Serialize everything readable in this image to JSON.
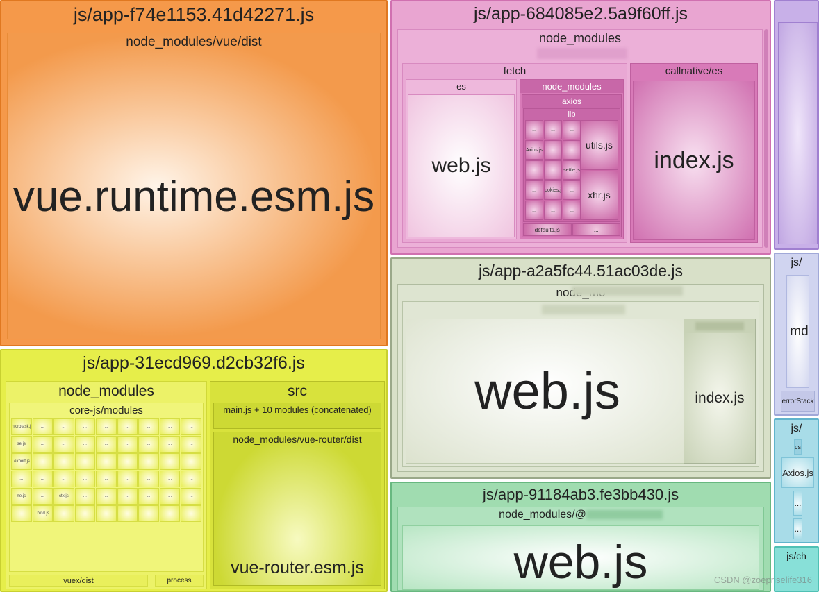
{
  "watermark": "CSDN @zoepriselife316",
  "bundles": {
    "orange": {
      "title": "js/app-f74e1153.41d42271.js",
      "path": "node_modules/vue/dist",
      "file": "vue.runtime.esm.js"
    },
    "yellow": {
      "title": "js/app-31ecd969.d2cb32f6.js",
      "nm": {
        "label": "node_modules",
        "core": "core-js/modules",
        "cells": [
          ".microtask.js",
          "...",
          "...",
          "...",
          "...",
          "...",
          "...",
          "...",
          "...",
          "se.js",
          "...",
          "...",
          "...",
          "...",
          "...",
          "...",
          "...",
          "...",
          ".export.js",
          "...",
          "...",
          "...",
          "...",
          "...",
          "...",
          "...",
          "...",
          "...",
          "...",
          "...",
          "...",
          "...",
          "...",
          "...",
          "...",
          "...",
          "ne.js",
          "...",
          "ctx.js",
          "...",
          "...",
          "...",
          "...",
          "...",
          "...",
          "...",
          ".bind.js",
          "...",
          "...",
          "...",
          "...",
          "...",
          "...",
          ""
        ],
        "vuex": "vuex/dist",
        "process": "process"
      },
      "src": {
        "label": "src",
        "main": "main.js + 10 modules (concatenated)",
        "router_path": "node_modules/vue-router/dist",
        "router_file": "vue-router.esm.js"
      }
    },
    "pink": {
      "title": "js/app-684085e2.5a9f60ff.js",
      "nm": "node_modules",
      "fetch": {
        "label": "fetch",
        "es": {
          "label": "es",
          "file": "web.js"
        },
        "nm2": "node_modules",
        "axios": {
          "label": "axios",
          "lib": "lib",
          "leftCells": [
            "...",
            "...",
            "...",
            "Axios.js",
            "...",
            "...",
            "...",
            "...",
            "settle.js",
            "...",
            "cookies.js",
            "...",
            "...",
            "...",
            "..."
          ],
          "right": [
            "utils.js",
            "xhr.js"
          ],
          "bot": [
            "defaults.js",
            "..."
          ]
        }
      },
      "call": {
        "label": "callnative/es",
        "file": "index.js"
      }
    },
    "olive": {
      "title": "js/app-a2a5fc44.51ac03de.js",
      "nm": "node_mo",
      "web": "web.js",
      "idx_suffix": "s",
      "idx": "index.js"
    },
    "green": {
      "title": "js/app-91184ab3.fe3bb430.js",
      "nm": "node_modules/@",
      "file": "web.js"
    },
    "purple": {
      "title": ""
    },
    "lavender": {
      "title": "js/",
      "main": "md",
      "sub": "errorStack"
    },
    "cyan": {
      "title": "js/",
      "r1": "cs",
      "r2": "Axios.js",
      "r3": "...",
      "r4": "..."
    },
    "teal": {
      "title": "js/ch"
    }
  }
}
